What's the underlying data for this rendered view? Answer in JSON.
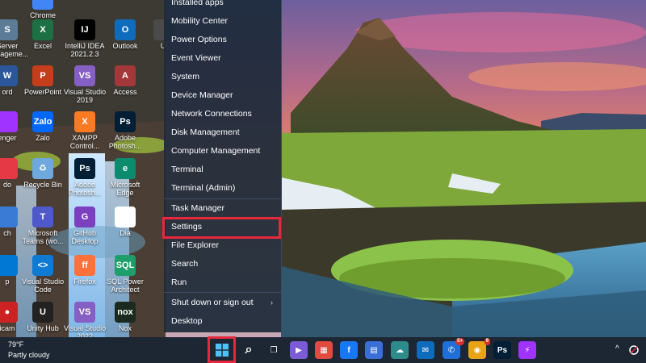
{
  "desktop": {
    "icons": [
      {
        "label": "Chrome",
        "color": "#4285f4",
        "glyph": ""
      },
      {
        "label": "Server\nManageme...",
        "color": "#5c7b96",
        "glyph": "S"
      },
      {
        "label": "Excel",
        "color": "#1d7044",
        "glyph": "X"
      },
      {
        "label": "IntelliJ IDEA\n2021.2.3",
        "color": "#000000",
        "glyph": "IJ"
      },
      {
        "label": "Outlook",
        "color": "#0f6cbd",
        "glyph": "O"
      },
      {
        "label": "Ul",
        "color": "#4a4a4a",
        "glyph": ""
      },
      {
        "label": "ord",
        "color": "#2b579a",
        "glyph": "W"
      },
      {
        "label": "PowerPoint",
        "color": "#c43e1c",
        "glyph": "P"
      },
      {
        "label": "Visual Studio\n2019",
        "color": "#865fc5",
        "glyph": "VS"
      },
      {
        "label": "Access",
        "color": "#a4373a",
        "glyph": "A"
      },
      {
        "label": "enger",
        "color": "#a033ff",
        "glyph": ""
      },
      {
        "label": "Zalo",
        "color": "#0068ff",
        "glyph": "Zalo"
      },
      {
        "label": "XAMPP\nControl...",
        "color": "#fb7a24",
        "glyph": "X"
      },
      {
        "label": "Adobe\nPhotosh...",
        "color": "#001e36",
        "glyph": "Ps"
      },
      {
        "label": "do",
        "color": "#e63946",
        "glyph": ""
      },
      {
        "label": "Recycle Bin",
        "color": "#6fa8dc",
        "glyph": "♻"
      },
      {
        "label": "Adobe\nPhotosh...",
        "color": "#001e36",
        "glyph": "Ps"
      },
      {
        "label": "Microsoft\nEdge",
        "color": "#0c8c6e",
        "glyph": "e"
      },
      {
        "label": "ch",
        "color": "#3a7bd5",
        "glyph": ""
      },
      {
        "label": "Microsoft\nTeams (wo...",
        "color": "#5059c9",
        "glyph": "T"
      },
      {
        "label": "GitHub\nDesktop",
        "color": "#7b3fbf",
        "glyph": "G"
      },
      {
        "label": "Dia",
        "color": "#ffffff",
        "glyph": "D"
      },
      {
        "label": "p",
        "color": "#0078d4",
        "glyph": ""
      },
      {
        "label": "Visual Studio\nCode",
        "color": "#0e7ad3",
        "glyph": "<>"
      },
      {
        "label": "Firefox",
        "color": "#ff7139",
        "glyph": "ff"
      },
      {
        "label": "SQL Power\nArchitect",
        "color": "#1e9e6a",
        "glyph": "SQL"
      },
      {
        "label": "icam",
        "color": "#cc2222",
        "glyph": "●"
      },
      {
        "label": "Unity Hub",
        "color": "#222222",
        "glyph": "U"
      },
      {
        "label": "Visual Studio\n2022",
        "color": "#865fc5",
        "glyph": "VS"
      },
      {
        "label": "Nox",
        "color": "#1b2a1f",
        "glyph": "nox"
      }
    ]
  },
  "winx_menu": {
    "items": [
      {
        "label": "Installed apps",
        "submenu": false
      },
      {
        "label": "Mobility Center",
        "submenu": false
      },
      {
        "label": "Power Options",
        "submenu": false
      },
      {
        "label": "Event Viewer",
        "submenu": false
      },
      {
        "label": "System",
        "submenu": false
      },
      {
        "label": "Device Manager",
        "submenu": false
      },
      {
        "label": "Network Connections",
        "submenu": false
      },
      {
        "label": "Disk Management",
        "submenu": false
      },
      {
        "label": "Computer Management",
        "submenu": false
      },
      {
        "label": "Terminal",
        "submenu": false
      },
      {
        "label": "Terminal (Admin)",
        "submenu": false
      },
      {
        "label": "Task Manager",
        "submenu": false
      },
      {
        "label": "Settings",
        "submenu": false,
        "highlighted": true
      },
      {
        "label": "File Explorer",
        "submenu": false
      },
      {
        "label": "Search",
        "submenu": false
      },
      {
        "label": "Run",
        "submenu": false
      },
      {
        "label": "Shut down or sign out",
        "submenu": true,
        "chevron": "›"
      },
      {
        "label": "Desktop",
        "submenu": false
      }
    ],
    "highlight_color": "#e6283c"
  },
  "taskbar": {
    "weather": {
      "temperature": "79°F",
      "condition": "Partly cloudy"
    },
    "start_button": {
      "icon": "windows-logo-icon",
      "highlighted": true
    },
    "apps": [
      {
        "name": "search-icon",
        "glyph": "⌕",
        "color": "transparent"
      },
      {
        "name": "task-view-icon",
        "glyph": "❐",
        "color": "transparent"
      },
      {
        "name": "teams-chat-icon",
        "glyph": "▶",
        "color": "#7b5cd6"
      },
      {
        "name": "app-icon",
        "glyph": "▦",
        "color": "#e04a3f"
      },
      {
        "name": "facebook-icon",
        "glyph": "f",
        "color": "#1877f2"
      },
      {
        "name": "store-icon",
        "glyph": "▤",
        "color": "#3a6fd8"
      },
      {
        "name": "app-icon-2",
        "glyph": "☁",
        "color": "#2e8b8b"
      },
      {
        "name": "mail-icon",
        "glyph": "✉",
        "color": "#0f6cbd"
      },
      {
        "name": "messenger-app-icon",
        "glyph": "✆",
        "color": "#1f6fd6",
        "badge": "5+"
      },
      {
        "name": "chrome-icon",
        "glyph": "◉",
        "color": "#e8a317",
        "badge": "9"
      },
      {
        "name": "photoshop-icon",
        "glyph": "Ps",
        "color": "#001e36"
      },
      {
        "name": "messenger-icon",
        "glyph": "⚡",
        "color": "#a033ff"
      }
    ],
    "tray": {
      "chevron": "^",
      "network_icon": "network-icon"
    }
  }
}
